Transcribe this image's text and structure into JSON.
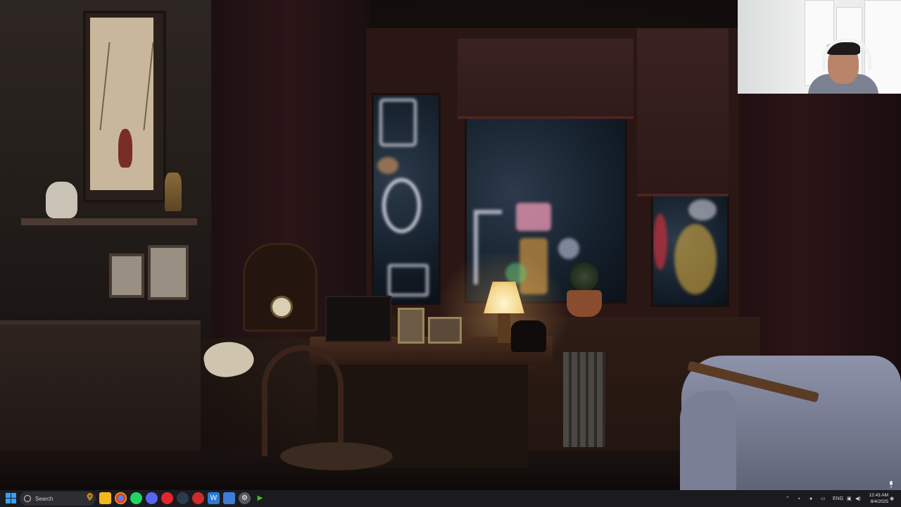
{
  "scene": {
    "description_tag": "game-scene",
    "webcam_overlay": true
  },
  "taskbar": {
    "search_placeholder": "Search",
    "apps": [
      {
        "name": "file-explorer-icon",
        "color": "#f2b81b"
      },
      {
        "name": "chrome-icon",
        "color": "#e34133"
      },
      {
        "name": "spotify-icon",
        "color": "#1ed760"
      },
      {
        "name": "discord-icon",
        "color": "#5865f2"
      },
      {
        "name": "record-app-icon",
        "color": "#e3262e"
      },
      {
        "name": "steam-icon",
        "color": "#2d3a4a"
      },
      {
        "name": "red-app-icon",
        "color": "#d02b2b"
      },
      {
        "name": "word-icon",
        "color": "#2b7cd3"
      },
      {
        "name": "blue-app-icon",
        "color": "#3d7dd8"
      },
      {
        "name": "settings-icon",
        "color": "#9aa0a8"
      },
      {
        "name": "green-arrow-icon",
        "color": "#46c11a"
      }
    ],
    "tray": {
      "language": "ENG",
      "time": "12:43 AM",
      "date": "8/4/2025"
    }
  }
}
